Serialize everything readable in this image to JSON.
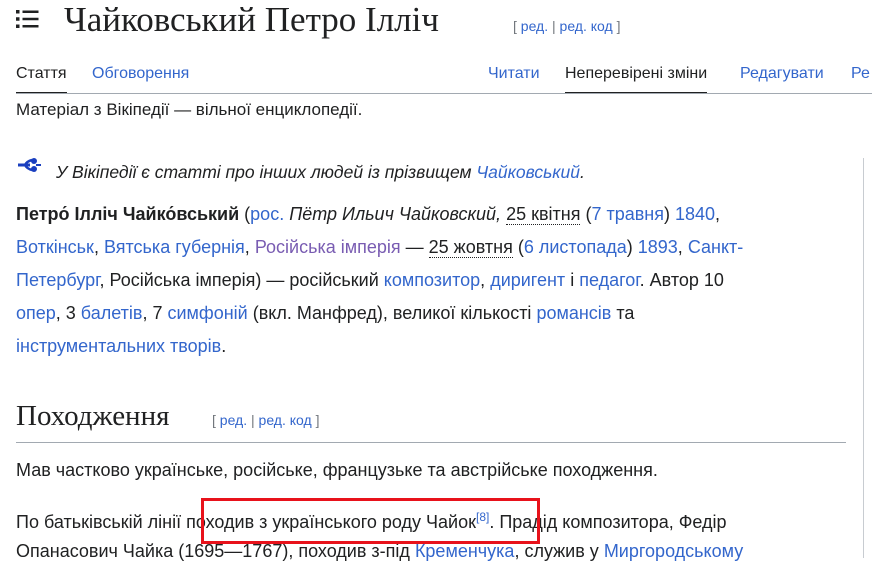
{
  "header": {
    "title": "Чайковський Петро Ілліч",
    "edit_open": "[",
    "edit_label": "ред.",
    "edit_sep": "|",
    "edit_code_label": "ред. код",
    "edit_close": "]",
    "toc_icon": "hamburger-list-icon"
  },
  "tabs": {
    "left": [
      {
        "label": "Стаття"
      },
      {
        "label": "Обговорення"
      }
    ],
    "right": [
      {
        "label": "Читати"
      },
      {
        "label": "Неперевірені зміни"
      },
      {
        "label": "Редагувати"
      },
      {
        "label": "Ре"
      }
    ]
  },
  "tagline": "Матеріал з Вікіпедії — вільної енциклопедії.",
  "hatnote": {
    "icon": "disambiguation-arrow-icon",
    "text": "У Вікіпедії є статті про інших людей із прізвищем ",
    "link": "Чайковський",
    "end": "."
  },
  "lead": {
    "l1": {
      "name": "Петро́ Ілліч Чайко́вський",
      "open": " (",
      "lang": "рос.",
      "ru_name": " Пётр Ильич Чайковский, ",
      "birth_date": "25 квітня",
      "birth_ns_open": " (",
      "birth_ns": "7 травня",
      "birth_ns_close": ") ",
      "birth_year": "1840",
      "comma": ","
    },
    "l2": {
      "place1": "Воткінськ",
      "c1": ", ",
      "place2": "Вятська губернія",
      "c2": ", ",
      "place3": "Російська імперія",
      "dash": " — ",
      "death_date": "25 жовтня",
      "death_ns_open": " (",
      "death_ns": "6 листопада",
      "death_ns_close": ") ",
      "death_year": "1893",
      "c3": ", ",
      "death_place_a": "Санкт-"
    },
    "l3": {
      "death_place_b": "Петербург",
      "rest": ", Російська імперія)  — російський ",
      "composer": "композитор",
      "c1": ", ",
      "conductor": "диригент",
      "and": " і ",
      "teacher": "педагог",
      "tail": ". Автор 10"
    },
    "l4": {
      "operas": "опер",
      "c1": ", 3 ",
      "ballets": "балетів",
      "c2": ", 7 ",
      "symphonies": "симфоній",
      "mid": " (вкл. Манфред), великої кількості ",
      "romances": "романсів",
      "tail": " та"
    },
    "l5": {
      "works": "інструментальних творів",
      "end": "."
    }
  },
  "section": {
    "heading": "Походження",
    "edit_open": "[",
    "edit_label": "ред.",
    "edit_sep": "|",
    "edit_code_label": "ред. код",
    "edit_close": "]"
  },
  "para1": "Мав частково українське, російське, французьке та австрійське походження.",
  "para2": {
    "l1_start": "По батьківській лінії ",
    "l1_highlight": "походив з українського роду Чайок",
    "l1_ref": "[8]",
    "l1_end": ". Прадід композитора, Федір",
    "l2_start": "Опанасович Чайка (1695—1767), походив з-під ",
    "l2_link1": "Кременчука",
    "l2_mid": ", служив у ",
    "l2_link2": "Миргородському"
  },
  "colors": {
    "link": "#3366cc",
    "visited_link": "#795cb2",
    "text": "#202122",
    "highlight_box": "#e8121b",
    "rule": "#a2a9b1"
  }
}
